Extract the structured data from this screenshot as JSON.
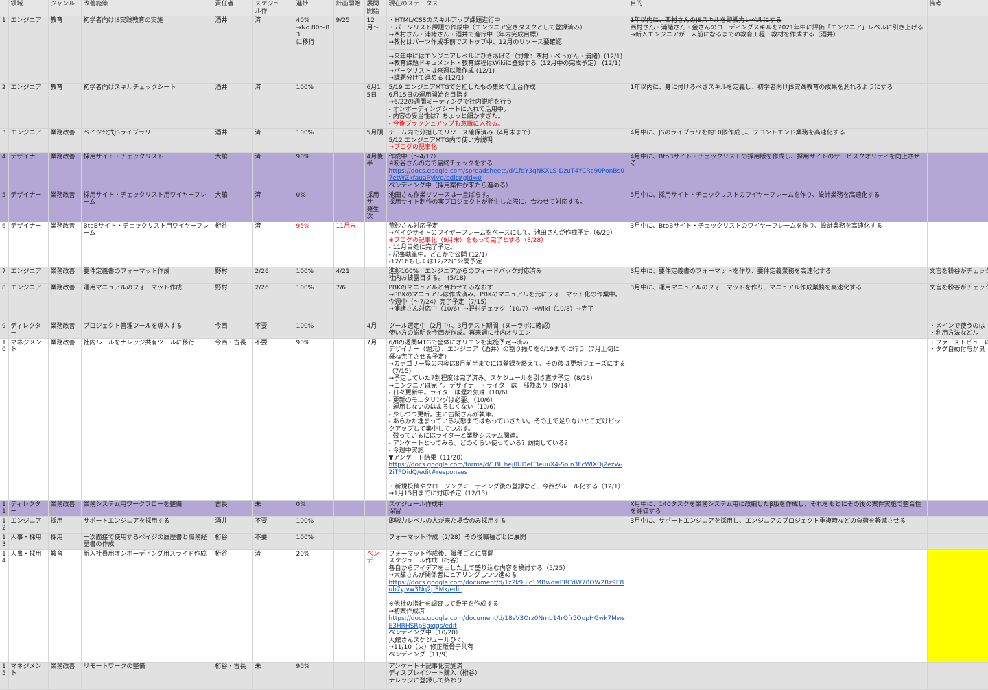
{
  "headers": [
    "",
    "領域",
    "ジャンル",
    "改善施策",
    "責任者",
    "スケジュール作",
    "進捗",
    "計画開始",
    "展開開始",
    "現在のステータス",
    "目的",
    "備考"
  ],
  "rows": [
    {
      "num": "1",
      "ryoiki": "エンジニア",
      "genre": "教育",
      "kaizen": "初学者向けJS実践教育の実施",
      "owner": "酒井",
      "schedule": "済",
      "progress": "40%\n→No.80〜83\nに移行",
      "plan": "9/25",
      "tenkai": "12月〜",
      "status": [
        "・HTML/CSSのスキルアップ課題進行中",
        "・パーツリスト課題の作成中（エンジニア空きタスクとして登録済み）",
        "→西村さん・浦諸さん・酒井で進行中（年内完成目標）",
        "→教材はパーツ作成手前でストップ中、12月のリソース要確認",
        "-------------------",
        "→来年中にはエンジニアレベルにひきあげる（対象：西村・べっかん・浦諸）(12/1)",
        "→教育課題ドキュメント・教育課程はWikiに登録する（12月中の完成予定） (12/1)",
        "→パーツリストは来週以降作成 (12/1)",
        "→課題分けて進める (12/1)"
      ],
      "purpose": [
        "1年以内に、西村さんのJSスキルを即戦力レベルにする",
        "西村さん・浦諸さん・金さんのコーディングスキルを2021年中に評価「エンジニア」レベルに引き上げる",
        "→新入エンジニアが一人前になるまでの教育工程・教材を作成する（酒井）"
      ],
      "note": ""
    },
    {
      "num": "2",
      "ryoiki": "エンジニア",
      "genre": "教育",
      "kaizen": "初学者向けスキルチェックシート",
      "owner": "酒井",
      "schedule": "済",
      "progress": "100%",
      "plan": "",
      "tenkai": "6月15日",
      "status": [
        "5/19 エンジニアMTGで分担したもの集めて土台作成",
        "6月15日の運用開始を目指す",
        "→6/22の週間ミーティングで社内説明を行う",
        "- オンボーディングシートに入れて活用中。",
        "- 内容の妥当性は？ちょっと細かすぎた。",
        "- 今後ブラッシュアップも意識に入れる。"
      ],
      "purpose": [
        "1年以内に、身に付けるべきスキルを定義し、初学者向けJS実践教育の成果を測れるようにする"
      ],
      "note": ""
    },
    {
      "num": "3",
      "ryoiki": "エンジニア",
      "genre": "業務改善",
      "kaizen": "ベイジ公式JSライブラリ",
      "owner": "酒井",
      "schedule": "済",
      "progress": "100%",
      "plan": "",
      "tenkai": "5月頭",
      "status": [
        "チーム内で分担してリソース確保済み（4月末まで）",
        "5/12 エンジニアMTG内で使い方説明",
        "→ブログの記事化"
      ],
      "purpose": [
        "4月中に、JSのライブラリを約10個作成し、フロントエンド業務を高速化する"
      ],
      "note": ""
    },
    {
      "num": "4",
      "ryoiki": "デザイナー",
      "genre": "業務改善",
      "kaizen": "採用サイト・チェックリスト",
      "owner": "大舘",
      "schedule": "済",
      "progress": "90%",
      "plan": "",
      "tenkai": "4月後半",
      "status": [
        "作成中（〜4/17）",
        "※粉谷さんの方で最終チェックをする",
        "https://docs.google.com/spreadsheets/d/1fdY3gNKXLS-DzuT4YCRc90PonBs07etWZkfauaRylVg/edit#gid=0",
        "ペンディング中（採用案件が来たら進める）"
      ],
      "purpose": [
        "4月中に、BtoBサイト・チェックリストの採用版を作成し、採用サイトのサービスクオリティを向上させる"
      ],
      "note": ""
    },
    {
      "num": "5",
      "ryoiki": "デザイナー",
      "genre": "業務改善",
      "kaizen": "採用サイト・チェックリスト用ワイヤーフレーム",
      "owner": "大舘",
      "schedule": "済",
      "progress": "0%",
      "plan": "",
      "tenkai": "採用サ\n発生次",
      "status": [
        "池田さん作業リソースは一旦ばらす。",
        "採用サイト制作の実プロジェクトが発生した際に、合わせて対応する。"
      ],
      "purpose": [
        "5月中に、採用サイト・チェックリストのワイヤーフレームを作り、設計業務を高速化する"
      ],
      "note": ""
    },
    {
      "num": "6",
      "ryoiki": "デザイナー",
      "genre": "業務改善",
      "kaizen": "BtoBサイト・チェックリスト用ワイヤーフレーム",
      "owner": "桁谷",
      "schedule": "済",
      "progress": "95%",
      "plan": "11月末",
      "tenkai": "",
      "status": [
        "荒砂さん対応予定",
        "→ベイジサイトのワイヤーフレームをベースにして、池田さんが作成予定（6/29）",
        "※ブログの記事化（9月末）をもって完了とする（8/28）",
        "- 11月目処に完了予定。",
        "- 記事執筆中。どこかで公開 (12/1)",
        "-12/16もしくは12/22に公開予定"
      ],
      "purpose": [
        "3月中に、BtoBサイト・チェックリストのワイヤーフレームを作り、設計業務を高速化する"
      ],
      "note": ""
    },
    {
      "num": "7",
      "ryoiki": "エンジニア",
      "genre": "業務改善",
      "kaizen": "要件定義書のフォーマット作成",
      "owner": "野村",
      "schedule": "2/26",
      "progress": "100%",
      "plan": "4/21",
      "tenkai": "",
      "status": [
        "進捗100%　エンジニアからのフィードバック対応済み",
        "社内お披露目する。　(5/18)"
      ],
      "purpose": [
        "3月中に、要件定義書のフォーマットを作り、要件定義業務を高速化する"
      ],
      "note": "文言を粉谷がチェック"
    },
    {
      "num": "8",
      "ryoiki": "エンジニア",
      "genre": "業務改善",
      "kaizen": "運用マニュアルのフォーマット作成",
      "owner": "野村",
      "schedule": "2/26",
      "progress": "100%",
      "plan": "7/6",
      "tenkai": "",
      "status": [
        "PBKのマニュアルと合わせてみなおす",
        "→PBKのマニュアルは作成済み。PBKのマニュアルを元にフォーマット化の作業中。今週中（〜7/24）完了予定（7/15）",
        "→浦諸さん対応中（10/6）→野村チェック（10/7）→Wiki（10/8）→完了"
      ],
      "purpose": [
        "3月中に、運用マニュアルのフォーマットを作り、マニュアル作成業務を高速化する"
      ],
      "note": "文言を粉谷がチェック"
    },
    {
      "num": "9",
      "ryoiki": "ディレクター",
      "genre": "業務改善",
      "kaizen": "プロジェクト管理ツールを導入する",
      "owner": "今西",
      "schedule": "不要",
      "progress": "100%",
      "plan": "",
      "tenkai": "4月",
      "status": [
        "ツール選定中（2月中）、3月テスト期間（ヌーラボに確認）",
        "使い方の説明を今西が作成。再来週に社内オリエン"
      ],
      "purpose": [
        ""
      ],
      "note": "・メインで使うのは\n・利用方法などル"
    },
    {
      "num": "10",
      "ryoiki": "マネジメント",
      "genre": "業務改善",
      "kaizen": "社内ルールをナレッジ共有ツールに移行",
      "owner": "今西・古長",
      "schedule": "不要",
      "progress": "90%",
      "plan": "",
      "tenkai": "7月",
      "status": [
        "6/8の週間MTGで全体にオリエンを実施予定→済み",
        "デザイナー（堀元）、エンジニア（酒井）の割り振りを6/19までに行う（7月上旬に概ね完了させる予定）",
        "→カテゴリー覧の内容は8月前半までには登録を終えて、その後は更新フェーズにする（7/15）",
        "→予定していた7割程度は完了済み。スケジュールを引き直す予定（8/28）",
        "→エンジニアは完了。デザイナー・ライターは一部残あり（9/14）",
        "- 日々更新中。ライターは遅れ気味（10/6）",
        "- 更新のモニタリングは必要。（10/6）",
        "- 運用しないのはよろしくない（10/6）",
        "- 少しづつ更新。主に古閑さんが執筆。",
        "- あらかた埋まっている状態まではもっていきたい。その上で足りないとこだけピックアップして集中してつぶす。",
        "- 残っているにはライターと業務システム関連。",
        "- アンケートとってみる。どのくらい使っている？訪問している？",
        "- 今週中実施",
        "▼アンケート結果（11/20）",
        "https://docs.google.com/forms/d/1BI_hej0UDeC3euuX4-Soln3FcWlXDj2ezW-2iTPDidQ/edit#responses",
        "",
        "・新規投稿やクロージングミーティング後の登録など、今西がルール化する（12/1）",
        "→1月15日までに対応予定（12/15）"
      ],
      "purpose": [
        ""
      ],
      "note": "・ファーストビューに\n・タグ自動付与が良"
    },
    {
      "num": "11",
      "ryoiki": "ディレクター",
      "genre": "業務改善",
      "kaizen": "業務システム用ワークフローを整備",
      "owner": "古長",
      "schedule": "未",
      "progress": "0%",
      "plan": "",
      "tenkai": "",
      "status": [
        "スケジュール作成中",
        "保留"
      ],
      "purpose": [
        "X月中に、140タスクを業務システム用に改編したβ版を作成し、それをもとにその後の案件実施で整合性を評価する"
      ],
      "note": ""
    },
    {
      "num": "12",
      "ryoiki": "エンジニア",
      "genre": "採用",
      "kaizen": "サポートエンジニアを採用する",
      "owner": "酒井",
      "schedule": "不要",
      "progress": "100%",
      "plan": "",
      "tenkai": "",
      "status": [
        "即戦力レベルの人が来た場合のみ採用する"
      ],
      "purpose": [
        "3月中に、サポートエンジニアを採用し、エンジニアのプロジェクト重複時などの負荷を軽減させる"
      ],
      "note": ""
    },
    {
      "num": "13",
      "ryoiki": "人事・採用",
      "genre": "採用",
      "kaizen": "一次面接で使用するベイジの履歴書と職務経歴書の作成",
      "owner": "桁谷",
      "schedule": "不要",
      "progress": "100%",
      "plan": "",
      "tenkai": "",
      "status": [
        "フォーマット作成（2/28）その後職種ごとに展開"
      ],
      "purpose": [
        ""
      ],
      "note": ""
    },
    {
      "num": "14",
      "ryoiki": "人事・採用",
      "genre": "教育",
      "kaizen": "新入社員用オンボーディング用スライド作成",
      "owner": "桁谷",
      "schedule": "済",
      "progress": "20%",
      "plan": "",
      "tenkai": "ペンデ",
      "status": [
        "フォーマット作成後、職種ごとに展開",
        "スケジュール作成（桁谷）",
        "各自からアイデアを出した上で盛り込む内容を検討する（5/25）",
        "→大舘さんが関係者にヒアリングしつつ進める",
        "https://docs.google.com/document/d/1z2k9uJc1MBwdwPRCdW78OW2Rz9E8uh7yjvw3Nq2pSMk/edit",
        "",
        "※他社の指針を調査して骨子を作成する",
        "→初案作成済",
        "https://docs.google.com/document/d/18sV3Orz0Nmb14rOfr5OupHGwk7MwsE3HRHSRp8giqgs/edit",
        "ペンディング中（10/20）",
        "大舘さんスケジュールひく。",
        "→11/10（火）修正版骨子共有",
        "ペンディング（11/9）"
      ],
      "purpose": [
        ""
      ],
      "note": ""
    },
    {
      "num": "15",
      "ryoiki": "マネジメント",
      "genre": "業務改善",
      "kaizen": "リモートワークの整備",
      "owner": "桁谷・古長",
      "schedule": "未",
      "progress": "90%",
      "plan": "",
      "tenkai": "",
      "status": [
        "アンケート＋記事化実施済",
        "ディスプレイシート購入（桁谷）",
        "ナレッジに登録して終わり"
      ],
      "purpose": [
        ""
      ],
      "note": ""
    }
  ],
  "colors": {
    "gray": "#e1e1e1",
    "purple": "#b4a7d6",
    "yellow": "#ffff00",
    "red": "#ff0000",
    "link": "#1155cc"
  }
}
